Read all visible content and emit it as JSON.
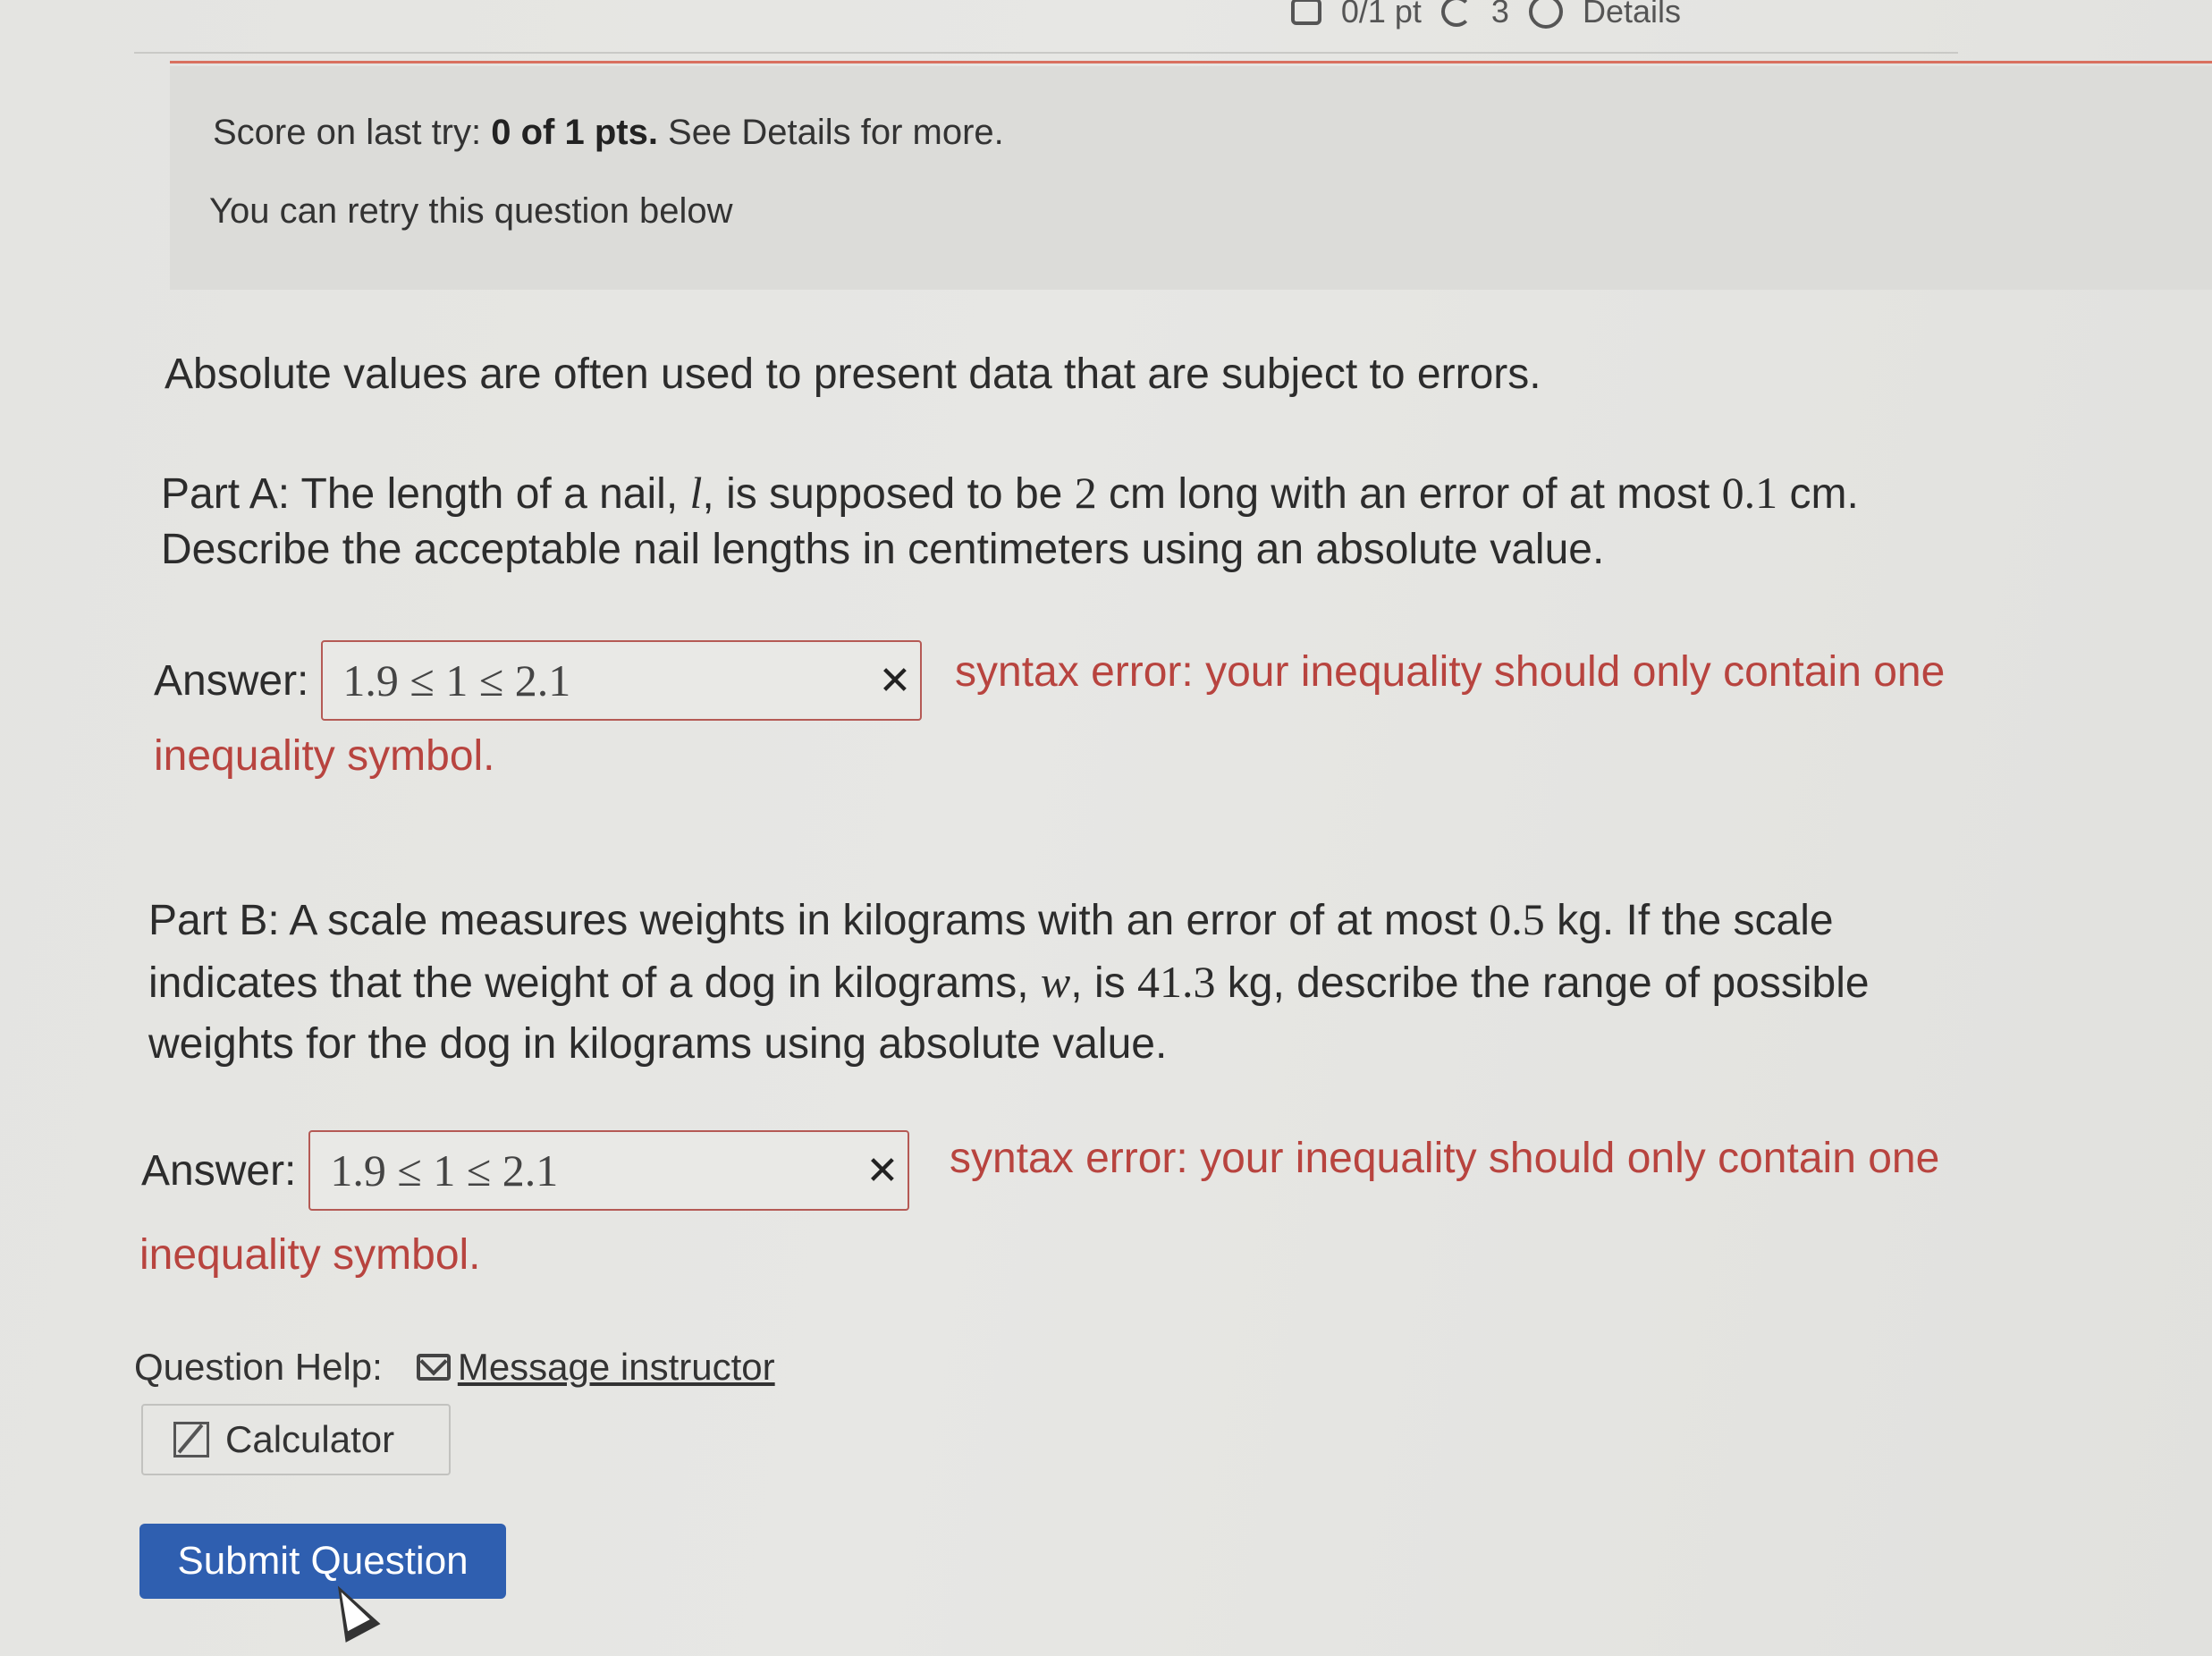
{
  "header": {
    "points": "0/1 pt",
    "retries": "3",
    "details_label": "Details"
  },
  "score": {
    "prefix": "Score on last try: ",
    "value": "0 of 1 pts.",
    "suffix": " See Details for more.",
    "retry_text": "You can retry this question below"
  },
  "question": {
    "intro": "Absolute values are often used to present data that are subject to errors.",
    "part_a": {
      "line1_pre": "Part A: The length of a nail, ",
      "var": "l",
      "line1_mid": ", is supposed to be ",
      "num1": "2",
      "line1_mid2": " cm long with an error of at most ",
      "num2": "0.1",
      "line1_post": " cm.",
      "line2": "Describe the acceptable nail lengths in centimeters using an absolute value."
    },
    "part_b": {
      "line1_pre": "Part B: A scale measures weights in kilograms with an error of at most ",
      "num1": "0.5",
      "line1_post": " kg. If the scale",
      "line2_pre": "indicates that the weight of a dog in kilograms, ",
      "var": "w",
      "line2_mid": ", is ",
      "num2": "41.3",
      "line2_post": " kg, describe the range of possible",
      "line3": "weights for the dog in kilograms using absolute value."
    }
  },
  "answers": [
    {
      "label": "Answer:",
      "value": "1.9 ≤ 1 ≤ 2.1",
      "error_line1": "syntax error: your inequality should only contain one",
      "error_line2": "inequality symbol."
    },
    {
      "label": "Answer:",
      "value": "1.9 ≤ 1 ≤ 2.1",
      "error_line1": "syntax error: your inequality should only contain one",
      "error_line2": "inequality symbol."
    }
  ],
  "help": {
    "label": "Question Help:",
    "message_link": "Message instructor",
    "calculator_label": "Calculator"
  },
  "submit_label": "Submit Question",
  "icons": {
    "points": "checkbox-icon",
    "retries": "retry-icon",
    "details": "info-icon",
    "clear": "close-icon",
    "mail": "mail-icon",
    "calculator": "calculator-icon",
    "cursor": "mouse-pointer-icon"
  }
}
